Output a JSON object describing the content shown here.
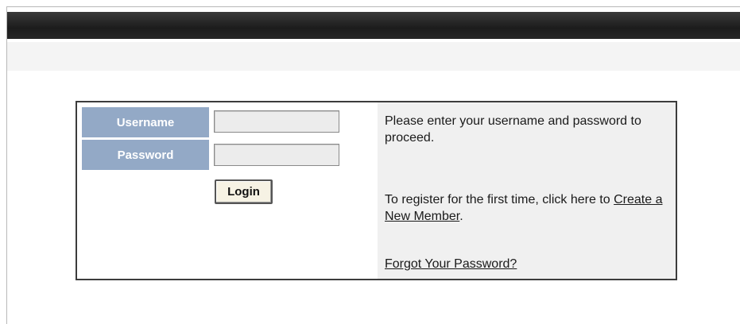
{
  "login_form": {
    "username_label": "Username",
    "password_label": "Password",
    "username_value": "",
    "password_value": "",
    "login_button": "Login"
  },
  "info": {
    "intro_text": "Please enter your username and password to proceed.",
    "register_text": "To register for the first time, click here to",
    "register_link": "Create a New Member",
    "register_suffix": ".",
    "forgot_link": "Forgot Your Password?"
  },
  "colors": {
    "top_bar": "#1c1c1c",
    "label_bg": "#93a9c6",
    "info_bg": "#f0f0f0",
    "button_bg": "#f6f2e4"
  }
}
